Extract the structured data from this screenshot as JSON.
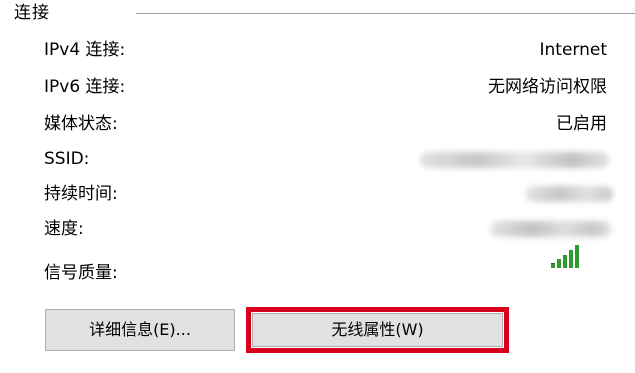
{
  "group": {
    "title": "连接"
  },
  "rows": [
    {
      "label": "IPv4 连接:",
      "value": "Internet"
    },
    {
      "label": "IPv6 连接:",
      "value": "无网络访问权限"
    },
    {
      "label": "媒体状态:",
      "value": "已启用"
    },
    {
      "label": "SSID:",
      "value": ""
    },
    {
      "label": "持续时间:",
      "value": ""
    },
    {
      "label": "速度:",
      "value": ""
    },
    {
      "label": "信号质量:",
      "value": ""
    }
  ],
  "signal": {
    "icon": "signal-strength-icon",
    "bars_total": 5,
    "bars_active": 5,
    "color": "#2e9b2e"
  },
  "buttons": {
    "details_label": "详细信息(E)...",
    "wireless_props_label": "无线属性(W)"
  },
  "colors": {
    "highlight": "#d9001b",
    "button_bg": "#e1e1e1",
    "button_border": "#adadad",
    "separator": "#a0a0a0"
  }
}
